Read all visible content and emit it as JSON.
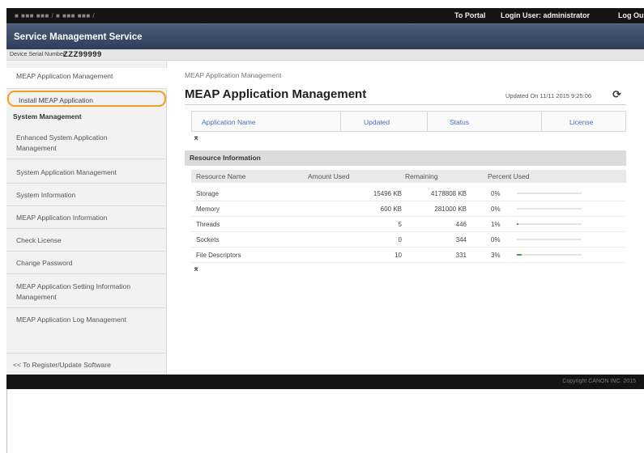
{
  "topbar": {
    "url": "■ ■■■ ■■■ / ■ ■■■ ■■■ /",
    "portal": "To Portal",
    "login": "Login User: administrator",
    "logout": "Log Out"
  },
  "header": {
    "title": "Service Management Service"
  },
  "serial": {
    "label": "Device Serial Number:",
    "value": "ZZZ99999"
  },
  "sidebar": {
    "top": "MEAP Application Management",
    "install": "Install MEAP Application",
    "section": "System Management",
    "items": [
      "Enhanced System Application Management",
      "System Application Management",
      "System Information",
      "MEAP Application Information",
      "Check License",
      "Change Password",
      "MEAP Application Setting Information Management",
      "MEAP Application Log Management"
    ],
    "register": "<< To Register/Update Software"
  },
  "main": {
    "breadcrumb": "MEAP Application Management",
    "title": "MEAP Application Management",
    "updated": "Updated On 11/11 2015 9:25:06",
    "refresh_icon": "refresh-icon",
    "app_table": {
      "columns": [
        "Application Name",
        "Updated",
        "Status",
        "License"
      ]
    },
    "resource": {
      "title": "Resource Information",
      "columns": [
        "Resource Name",
        "Amount Used",
        "Remaining",
        "Percent Used"
      ],
      "rows": [
        {
          "name": "Storage",
          "used": "15496 KB",
          "remaining": "4178808 KB",
          "percent": "0%",
          "fraction": 0.0
        },
        {
          "name": "Memory",
          "used": "600 KB",
          "remaining": "281000 KB",
          "percent": "0%",
          "fraction": 0.0
        },
        {
          "name": "Threads",
          "used": "5",
          "remaining": "446",
          "percent": "1%",
          "fraction": 0.01
        },
        {
          "name": "Sockets",
          "used": "0",
          "remaining": "344",
          "percent": "0%",
          "fraction": 0.0
        },
        {
          "name": "File Descriptors",
          "used": "10",
          "remaining": "331",
          "percent": "3%",
          "fraction": 0.03
        }
      ]
    }
  },
  "footer": {
    "copyright": "Copyright CANON INC. 2015"
  },
  "colors": {
    "header_bg": "#3b4b68",
    "highlight": "#f0a020",
    "bar": "#3fa64a"
  }
}
